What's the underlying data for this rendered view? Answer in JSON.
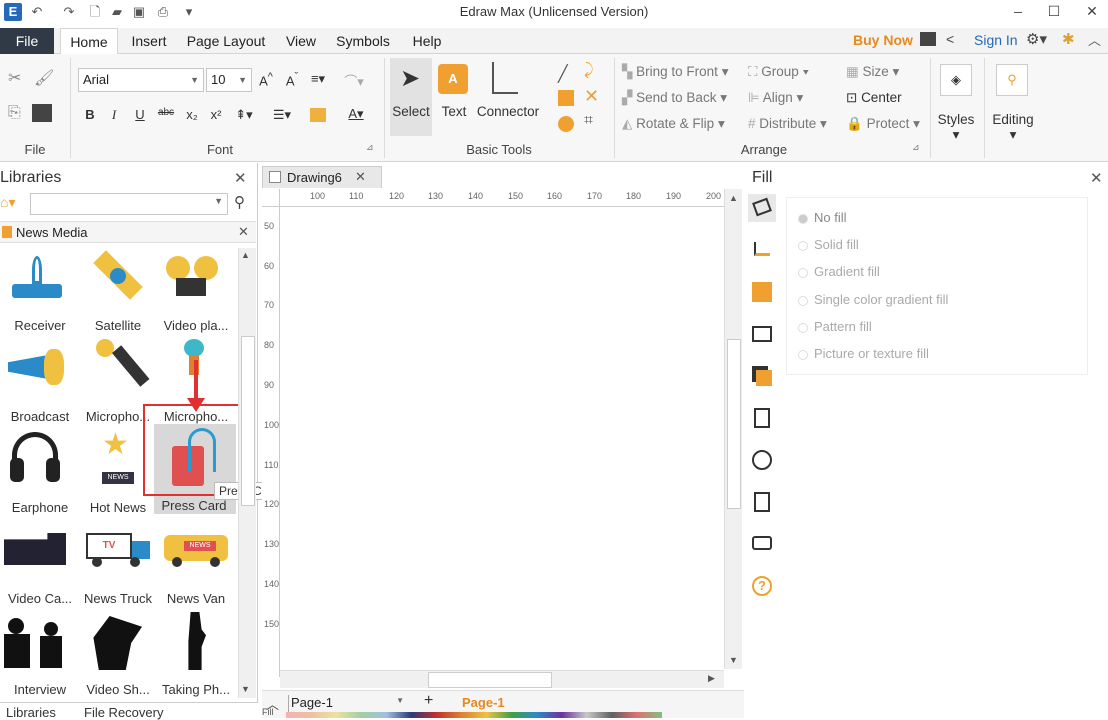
{
  "title": "Edraw Max (Unlicensed Version)",
  "menu": {
    "file": "File",
    "tabs": [
      "Home",
      "Insert",
      "Page Layout",
      "View",
      "Symbols",
      "Help"
    ],
    "buy_now": "Buy Now",
    "sign_in": "Sign In"
  },
  "ribbon": {
    "file_label": "File",
    "font": {
      "family": "Arial",
      "size": "10",
      "label": "Font"
    },
    "basic_tools": {
      "select": "Select",
      "text": "Text",
      "connector": "Connector",
      "label": "Basic Tools"
    },
    "arrange": {
      "bring_to_front": "Bring to Front",
      "send_to_back": "Send to Back",
      "rotate_flip": "Rotate & Flip",
      "group": "Group",
      "align": "Align",
      "distribute": "Distribute",
      "size": "Size",
      "center": "Center",
      "protect": "Protect",
      "label": "Arrange"
    },
    "styles": "Styles",
    "editing": "Editing"
  },
  "libraries": {
    "title": "Libraries",
    "category": "News Media",
    "shapes": [
      "Receiver",
      "Satellite",
      "Video pla...",
      "Broadcast",
      "Micropho...",
      "Micropho...",
      "Earphone",
      "Hot News",
      "Press Card",
      "Video Ca...",
      "News Truck",
      "News Van",
      "Interview",
      "Video Sh...",
      "Taking Ph..."
    ],
    "tooltip": "Press Card",
    "bottom_tabs": [
      "Libraries",
      "File Recovery"
    ]
  },
  "document": {
    "tab": "Drawing6",
    "ruler_h": [
      "100",
      "110",
      "120",
      "130",
      "140",
      "150",
      "160",
      "170",
      "180",
      "190",
      "200"
    ],
    "ruler_v": [
      "50",
      "60",
      "70",
      "80",
      "90",
      "100",
      "110",
      "120",
      "130",
      "140",
      "150"
    ],
    "page_select": "Page-1",
    "page_tab": "Page-1",
    "fill_label": "Fill"
  },
  "fill_panel": {
    "title": "Fill",
    "options": [
      "No fill",
      "Solid fill",
      "Gradient fill",
      "Single color gradient fill",
      "Pattern fill",
      "Picture or texture fill"
    ],
    "selected": "No fill"
  },
  "colors": {
    "accent": "#e8891d",
    "file_tab": "#2f3a46",
    "link": "#2569b8",
    "highlight": "#e03030"
  }
}
